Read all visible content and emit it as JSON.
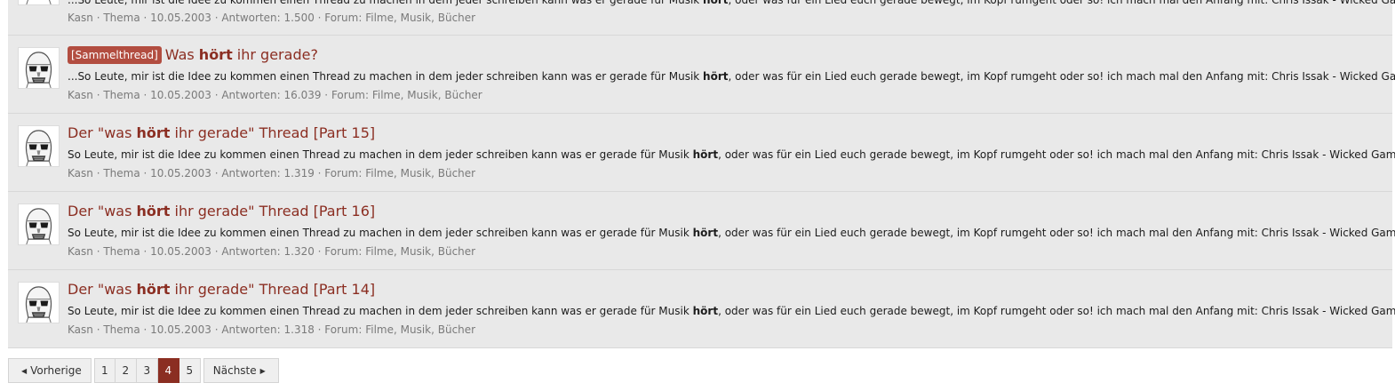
{
  "results": [
    {
      "prefix": "",
      "title_parts": [],
      "snippet_parts": [
        "...So Leute, mir ist die Idee zu kommen einen Thread zu machen in dem jeder schreiben kann was er gerade für Musik ",
        "hört",
        ", oder was für ein Lied euch gerade bewegt, im Kopf rumgeht oder so! ich mach mal den Anfang mit: Chris Issak - Wicked Games"
      ],
      "author": "Kasn",
      "type": "Thema",
      "date": "10.05.2003",
      "replies": "Antworten: 1.500",
      "forum_label": "Forum:",
      "forum": "Filme, Musik, Bücher"
    },
    {
      "prefix": "[Sammelthread]",
      "title_parts": [
        "Was ",
        "hört",
        " ihr gerade?"
      ],
      "snippet_parts": [
        "...So Leute, mir ist die Idee zu kommen einen Thread zu machen in dem jeder schreiben kann was er gerade für Musik ",
        "hört",
        ", oder was für ein Lied euch gerade bewegt, im Kopf rumgeht oder so! ich mach mal den Anfang mit: Chris Issak - Wicked Games"
      ],
      "author": "Kasn",
      "type": "Thema",
      "date": "10.05.2003",
      "replies": "Antworten: 16.039",
      "forum_label": "Forum:",
      "forum": "Filme, Musik, Bücher"
    },
    {
      "prefix": "",
      "title_parts": [
        "Der \"was ",
        "hört",
        " ihr gerade\" Thread [Part 15]"
      ],
      "snippet_parts": [
        "So Leute, mir ist die Idee zu kommen einen Thread zu machen in dem jeder schreiben kann was er gerade für Musik ",
        "hört",
        ", oder was für ein Lied euch gerade bewegt, im Kopf rumgeht oder so! ich mach mal den Anfang mit: Chris Issak - Wicked Games"
      ],
      "author": "Kasn",
      "type": "Thema",
      "date": "10.05.2003",
      "replies": "Antworten: 1.319",
      "forum_label": "Forum:",
      "forum": "Filme, Musik, Bücher"
    },
    {
      "prefix": "",
      "title_parts": [
        "Der \"was ",
        "hört",
        " ihr gerade\" Thread [Part 16]"
      ],
      "snippet_parts": [
        "So Leute, mir ist die Idee zu kommen einen Thread zu machen in dem jeder schreiben kann was er gerade für Musik ",
        "hört",
        ", oder was für ein Lied euch gerade bewegt, im Kopf rumgeht oder so! ich mach mal den Anfang mit: Chris Issak - Wicked Games"
      ],
      "author": "Kasn",
      "type": "Thema",
      "date": "10.05.2003",
      "replies": "Antworten: 1.320",
      "forum_label": "Forum:",
      "forum": "Filme, Musik, Bücher"
    },
    {
      "prefix": "",
      "title_parts": [
        "Der \"was ",
        "hört",
        " ihr gerade\" Thread [Part 14]"
      ],
      "snippet_parts": [
        "So Leute, mir ist die Idee zu kommen einen Thread zu machen in dem jeder schreiben kann was er gerade für Musik ",
        "hört",
        ", oder was für ein Lied euch gerade bewegt, im Kopf rumgeht oder so! ich mach mal den Anfang mit: Chris Issak - Wicked Games"
      ],
      "author": "Kasn",
      "type": "Thema",
      "date": "10.05.2003",
      "replies": "Antworten: 1.318",
      "forum_label": "Forum:",
      "forum": "Filme, Musik, Bücher"
    }
  ],
  "pagination": {
    "prev_label": "Vorherige",
    "next_label": "Nächste",
    "pages": [
      "1",
      "2",
      "3",
      "4",
      "5"
    ],
    "current": "4"
  },
  "icons": {
    "avatar": "stormtrooper-helmet-icon",
    "prev": "caret-left-icon",
    "next": "caret-right-icon"
  },
  "colors": {
    "accent": "#8b2e22",
    "prefix_bg": "#b24d40",
    "row_bg": "#e9e9e9"
  }
}
